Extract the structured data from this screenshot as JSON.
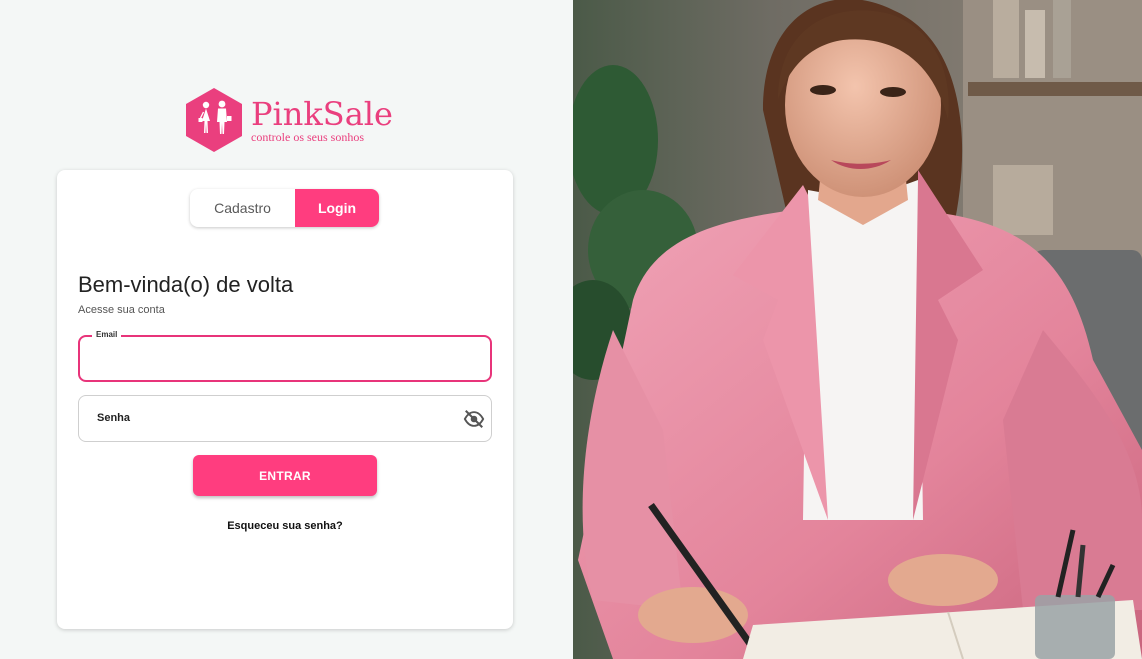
{
  "brand": {
    "name": "PinkSale",
    "tagline": "controle os seus sonhos",
    "logo_icon": "couple-hexagon-icon",
    "color": "#ea3f7e"
  },
  "tabs": {
    "signup_label": "Cadastro",
    "login_label": "Login",
    "active": "Login"
  },
  "form": {
    "title": "Bem-vinda(o) de volta",
    "subtitle": "Acesse sua conta",
    "email_label": "Email",
    "email_value": "",
    "password_label": "Senha",
    "password_value": "",
    "toggle_visibility_icon": "eye-off-icon",
    "submit_label": "ENTRAR",
    "forgot_label": "Esqueceu sua senha?"
  },
  "hero": {
    "image_icon": "woman-in-pink-blazer-writing-photo"
  },
  "colors": {
    "accent": "#ff3d7f",
    "focus_border": "#e8347a",
    "background": "#f4f7f6"
  }
}
